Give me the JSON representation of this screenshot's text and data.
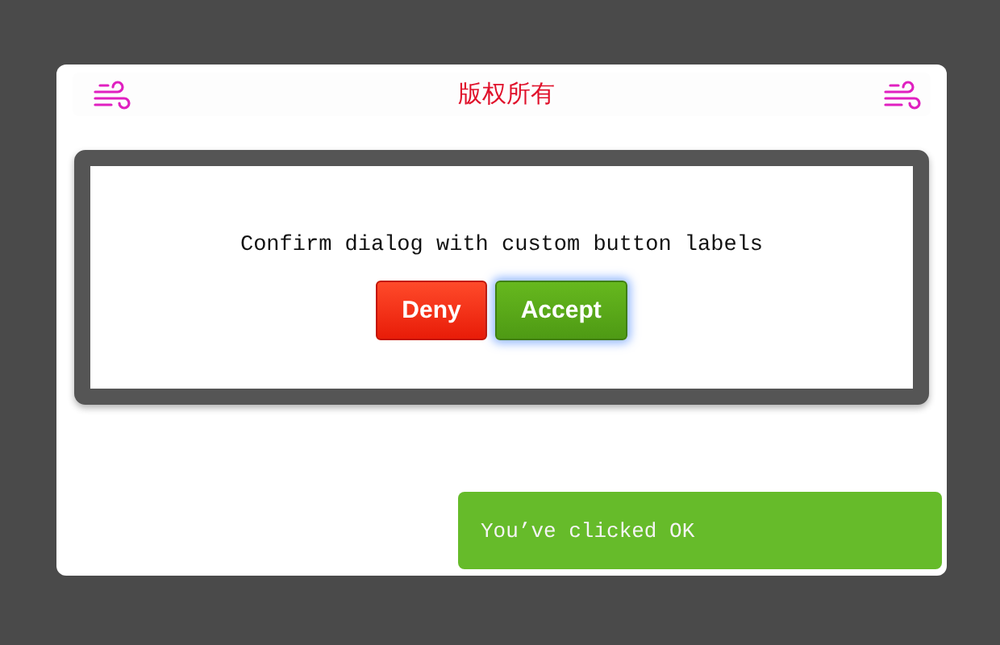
{
  "header": {
    "title": "版权所有"
  },
  "dialog": {
    "message": "Confirm dialog with custom button labels",
    "buttons": [
      {
        "label": "Deny",
        "kind": "deny",
        "focused": false
      },
      {
        "label": "Accept",
        "kind": "accept",
        "focused": true
      }
    ]
  },
  "toast": {
    "message": "You’ve clicked OK"
  }
}
